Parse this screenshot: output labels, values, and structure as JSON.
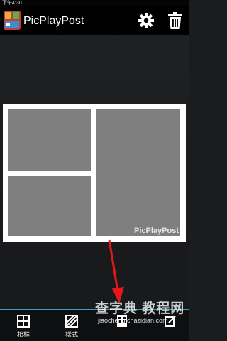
{
  "status_bar": {
    "time": "下午4:30"
  },
  "action_bar": {
    "title": "PicPlayPost",
    "settings_icon": "gear-icon",
    "trash_icon": "trash-icon"
  },
  "collage": {
    "layout": "three-cells",
    "background_color": "#ffffff",
    "cell_color": "#7f7f7f",
    "watermark": "PicPlayPost"
  },
  "annotation": {
    "arrow_color": "#e8161b"
  },
  "bottom_nav": {
    "accent_color": "#3aa0c8",
    "items": [
      {
        "label": "相框",
        "icon": "grid-icon"
      },
      {
        "label": "樣式",
        "icon": "stripes-icon"
      },
      {
        "label": "",
        "icon": "film-icon"
      },
      {
        "label": "",
        "icon": "edit-icon"
      }
    ]
  },
  "site_watermark": {
    "title": "查字典 教程网",
    "url": "jiaocheng.chazidian.com"
  }
}
